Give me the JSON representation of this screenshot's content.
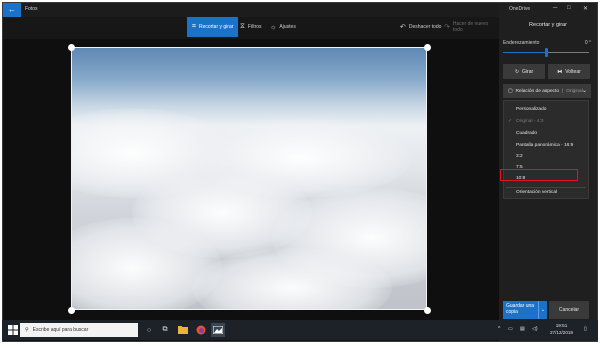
{
  "app": {
    "title": "Fotos",
    "back_glyph": "←"
  },
  "toolbar": {
    "crop_label": "Recortar y girar",
    "filters_label": "Filtros",
    "adjust_label": "Ajustes",
    "undo_label": "Deshacer todo",
    "redo_label": "Hacer de nuevo todo"
  },
  "panel": {
    "onedrive_label": "OneDrive",
    "title": "Recortar y girar",
    "straighten_label": "Enderezamiento",
    "straighten_value": "0 °",
    "straighten_level": 0.5,
    "rotate_label": "Girar",
    "flip_label": "Voltear",
    "ratio_label": "Relación de aspecto",
    "ratio_current": "Original",
    "ratio_options": [
      "Personalizado",
      "Original - 4:3",
      "Cuadrado",
      "Pantalla panorámica - 16:9",
      "3:2",
      "7:5",
      "10:8"
    ],
    "orientation_label": "Orientación vertical",
    "save_label": "Guardar una copia",
    "cancel_label": "Cancelar"
  },
  "taskbar": {
    "search_placeholder": "Escribe aquí para buscar",
    "time": "19:51",
    "date": "27/12/2019"
  },
  "colors": {
    "accent": "#1a73c9",
    "highlight": "#e0141c"
  }
}
